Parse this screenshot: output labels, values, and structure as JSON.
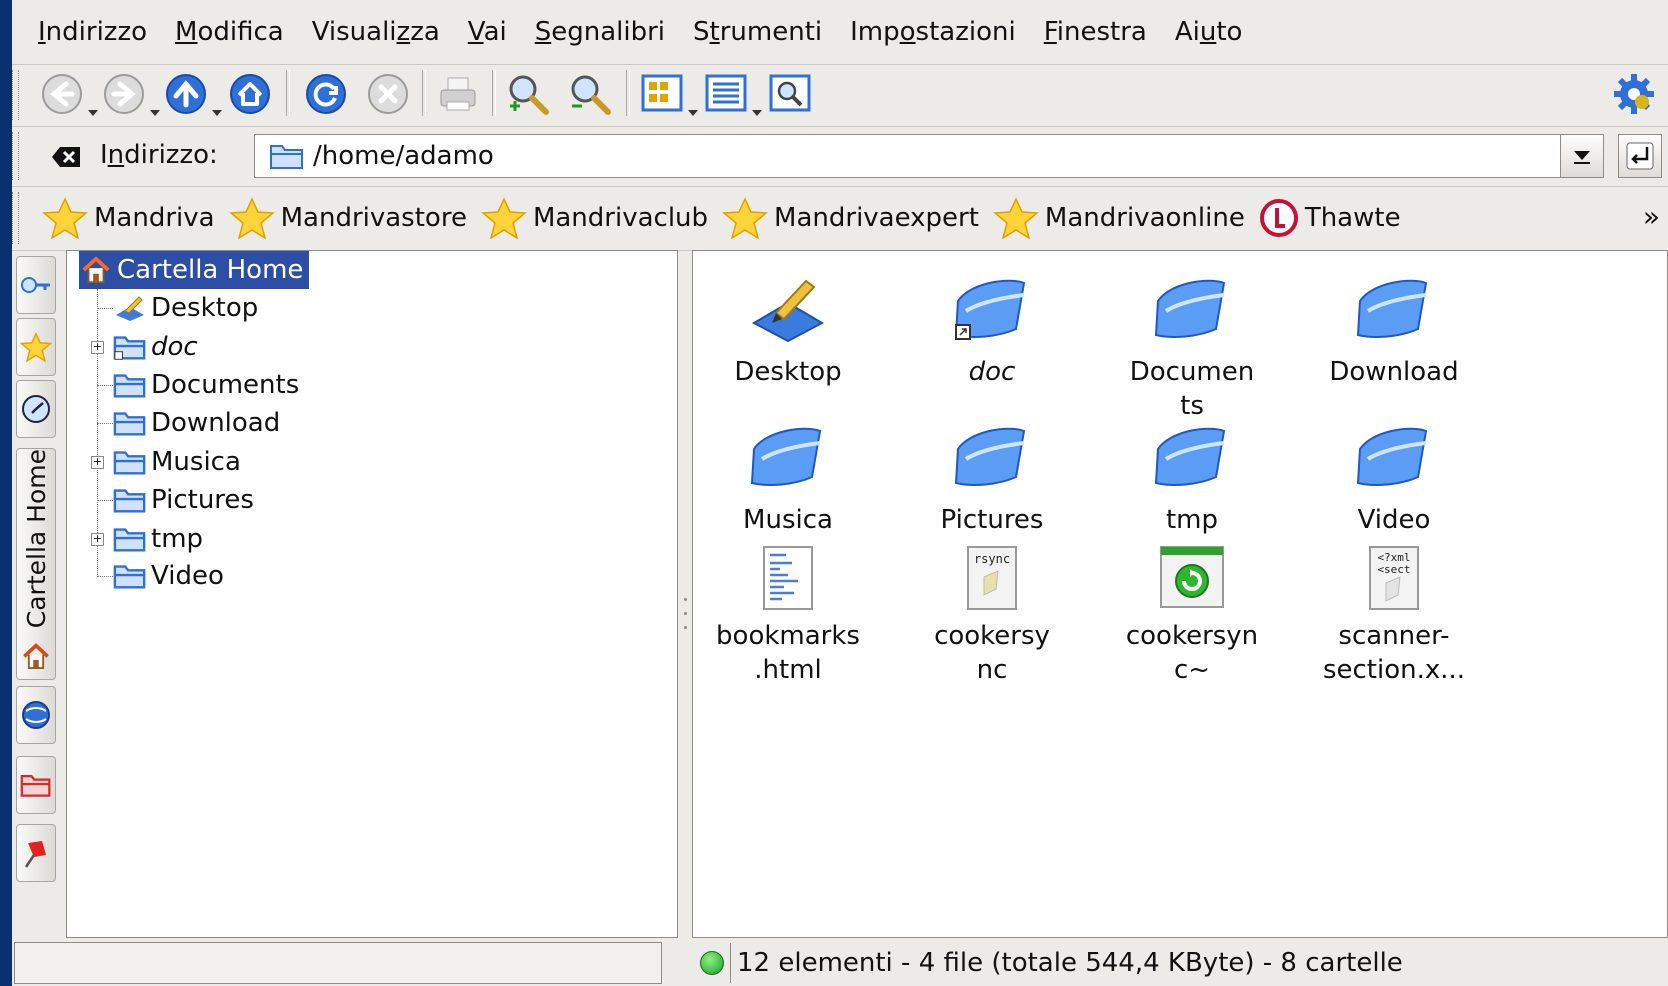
{
  "menubar": {
    "items": [
      {
        "pre": "",
        "ul": "I",
        "post": "ndirizzo"
      },
      {
        "pre": "",
        "ul": "M",
        "post": "odifica"
      },
      {
        "pre": "Visuali",
        "ul": "z",
        "post": "za"
      },
      {
        "pre": "",
        "ul": "V",
        "post": "ai"
      },
      {
        "pre": "",
        "ul": "S",
        "post": "egnalibri"
      },
      {
        "pre": "S",
        "ul": "t",
        "post": "rumenti"
      },
      {
        "pre": "Imp",
        "ul": "o",
        "post": "stazioni"
      },
      {
        "pre": "",
        "ul": "F",
        "post": "inestra"
      },
      {
        "pre": "Ai",
        "ul": "u",
        "post": "to"
      }
    ]
  },
  "location": {
    "label_pre": "I",
    "label_ul": "n",
    "label_post": "dirizzo:",
    "value": "/home/adamo"
  },
  "bookmarks": {
    "items": [
      "Mandriva",
      "Mandrivastore",
      "Mandrivaclub",
      "Mandrivaexpert",
      "Mandrivaonline",
      "Thawte"
    ],
    "more": "»"
  },
  "sidebar": {
    "tab_label": "Cartella Home"
  },
  "tree": {
    "root": "Cartella Home",
    "items": [
      {
        "label": "Desktop",
        "expandable": false,
        "italic": false
      },
      {
        "label": "doc",
        "expandable": true,
        "italic": true
      },
      {
        "label": "Documents",
        "expandable": false,
        "italic": false
      },
      {
        "label": "Download",
        "expandable": false,
        "italic": false
      },
      {
        "label": "Musica",
        "expandable": true,
        "italic": false
      },
      {
        "label": "Pictures",
        "expandable": false,
        "italic": false
      },
      {
        "label": "tmp",
        "expandable": true,
        "italic": false
      },
      {
        "label": "Video",
        "expandable": false,
        "italic": false
      }
    ]
  },
  "icons": {
    "items": [
      {
        "l1": "Desktop",
        "l2": "",
        "type": "desktop"
      },
      {
        "l1": "doc",
        "l2": "",
        "type": "folder-link"
      },
      {
        "l1": "Documen",
        "l2": "ts",
        "type": "folder"
      },
      {
        "l1": "Download",
        "l2": "",
        "type": "folder"
      },
      {
        "l1": "Musica",
        "l2": "",
        "type": "folder"
      },
      {
        "l1": "Pictures",
        "l2": "",
        "type": "folder"
      },
      {
        "l1": "tmp",
        "l2": "",
        "type": "folder"
      },
      {
        "l1": "Video",
        "l2": "",
        "type": "folder"
      },
      {
        "l1": "bookmarks",
        "l2": ".html",
        "type": "html-file"
      },
      {
        "l1": "cookersy",
        "l2": "nc",
        "type": "rsync-file"
      },
      {
        "l1": "cookersyn",
        "l2": "c~",
        "type": "backup-file"
      },
      {
        "l1": "scanner-",
        "l2": "section.x...",
        "type": "xml-file"
      }
    ]
  },
  "status": {
    "text": "12 elementi - 4 file (totale 544,4 KByte) - 8 cartelle"
  },
  "colors": {
    "desktop_bg": "#0b2f6f",
    "window_bg": "#ecebe8",
    "selection": "#2d4ea5",
    "folder_blue": "#2f6fd8"
  }
}
